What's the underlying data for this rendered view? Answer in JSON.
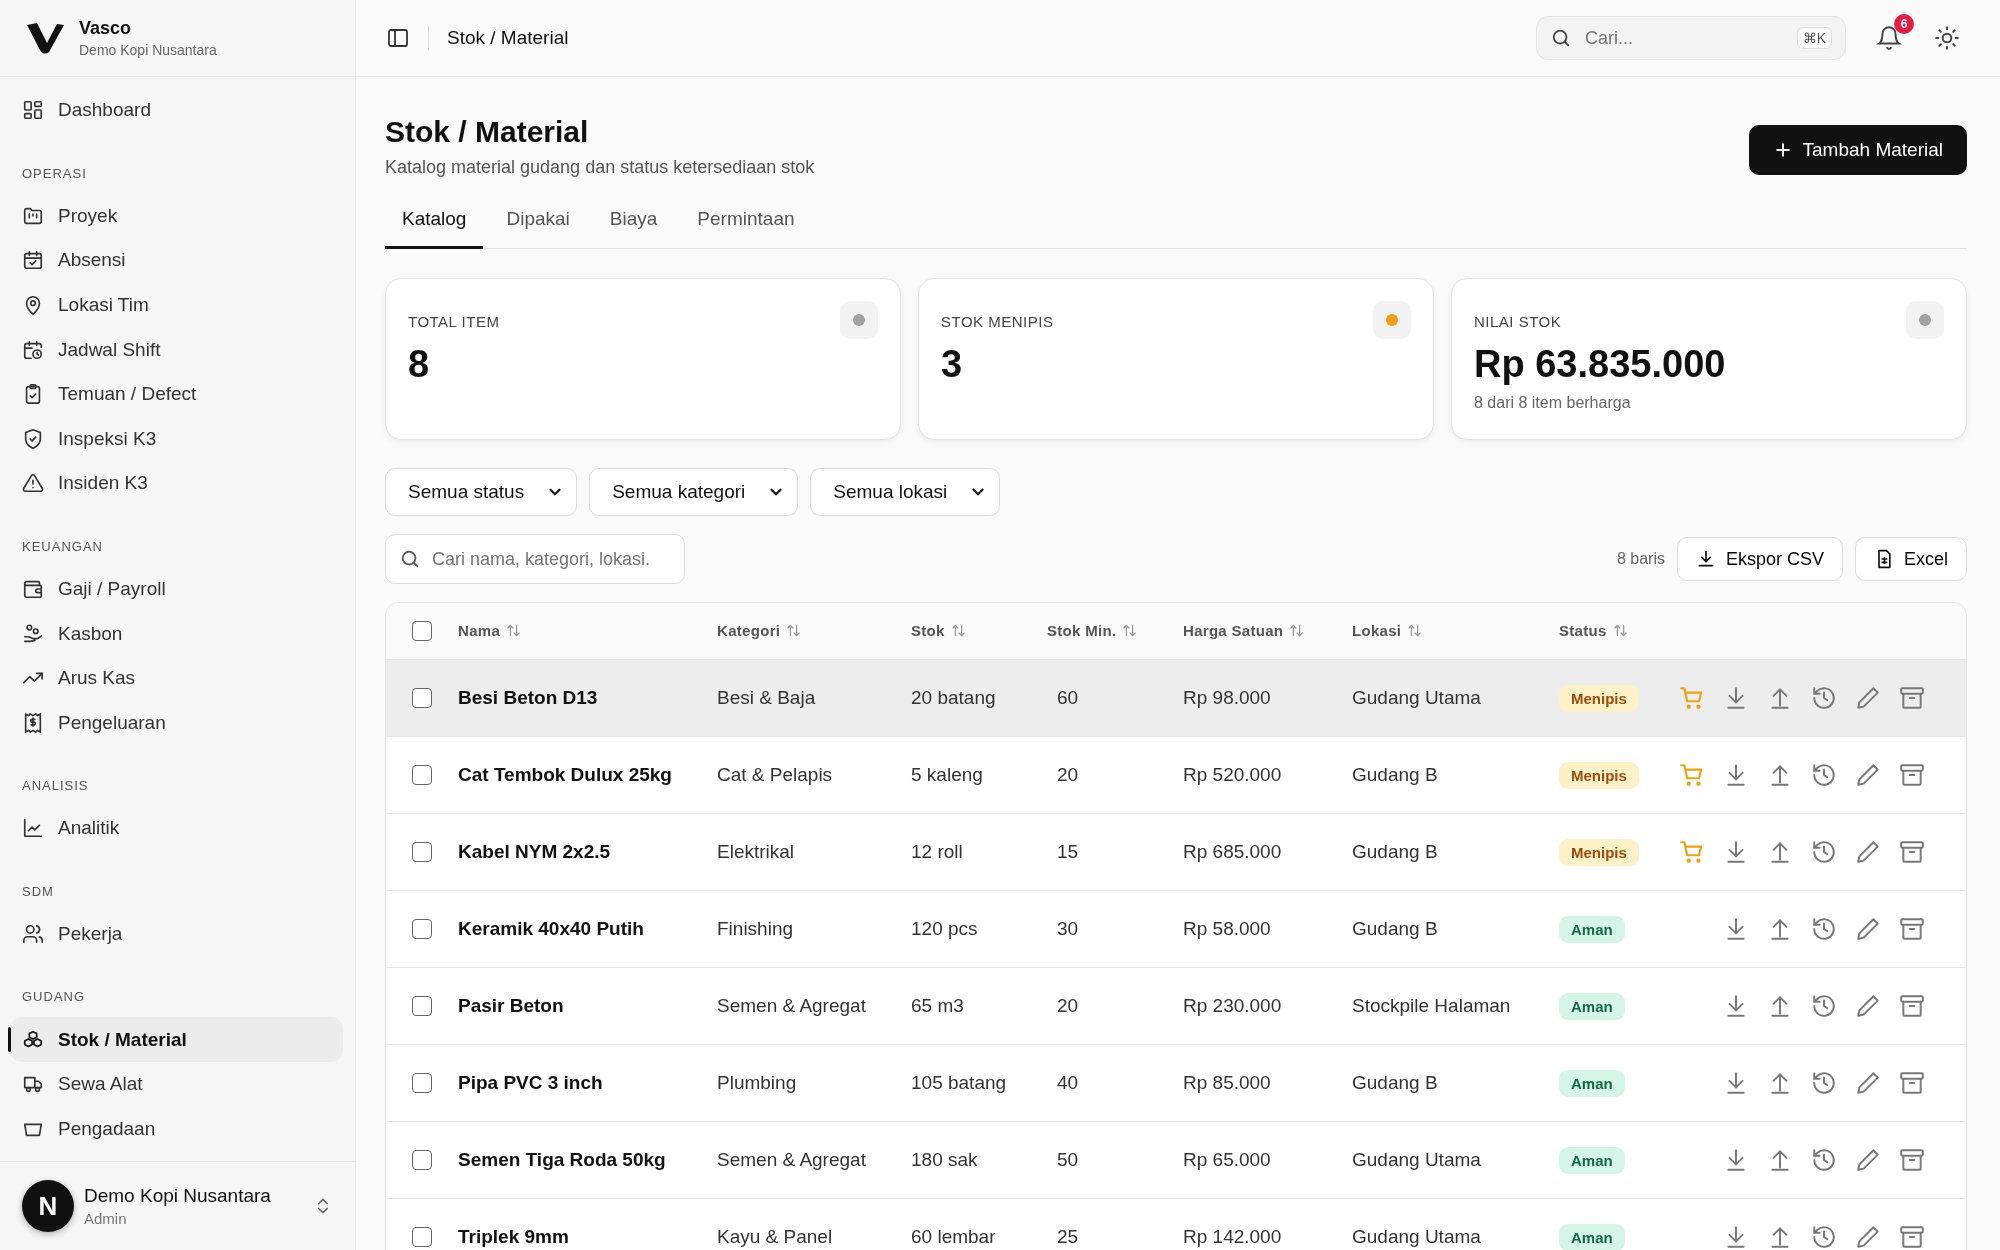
{
  "brand": {
    "name": "Vasco",
    "subtitle": "Demo Kopi Nusantara"
  },
  "sidebar": {
    "sections": [
      {
        "items": [
          {
            "label": "Dashboard",
            "selected": false
          }
        ]
      },
      {
        "title": "OPERASI",
        "items": [
          {
            "label": "Proyek",
            "selected": false
          },
          {
            "label": "Absensi",
            "selected": false
          },
          {
            "label": "Lokasi Tim",
            "selected": false
          },
          {
            "label": "Jadwal Shift",
            "selected": false
          },
          {
            "label": "Temuan / Defect",
            "selected": false
          },
          {
            "label": "Inspeksi K3",
            "selected": false
          },
          {
            "label": "Insiden K3",
            "selected": false
          }
        ]
      },
      {
        "title": "KEUANGAN",
        "items": [
          {
            "label": "Gaji / Payroll",
            "selected": false
          },
          {
            "label": "Kasbon",
            "selected": false
          },
          {
            "label": "Arus Kas",
            "selected": false
          },
          {
            "label": "Pengeluaran",
            "selected": false
          }
        ]
      },
      {
        "title": "ANALISIS",
        "items": [
          {
            "label": "Analitik",
            "selected": false
          }
        ]
      },
      {
        "title": "SDM",
        "items": [
          {
            "label": "Pekerja",
            "selected": false
          }
        ]
      },
      {
        "title": "GUDANG",
        "items": [
          {
            "label": "Stok / Material",
            "selected": true
          },
          {
            "label": "Sewa Alat",
            "selected": false
          },
          {
            "label": "Pengadaan",
            "selected": false
          }
        ]
      }
    ],
    "user": {
      "initial": "N",
      "name": "Demo Kopi Nusantara",
      "role": "Admin"
    }
  },
  "topbar": {
    "breadcrumb": "Stok / Material",
    "search": {
      "placeholder": "Cari...",
      "shortcut": "⌘K"
    },
    "notifications": "6"
  },
  "page": {
    "title": "Stok / Material",
    "subtitle": "Katalog material gudang dan status ketersediaan stok",
    "primary_button": "Tambah Material"
  },
  "tabs": [
    {
      "label": "Katalog",
      "selected": true
    },
    {
      "label": "Dipakai",
      "selected": false
    },
    {
      "label": "Biaya",
      "selected": false
    },
    {
      "label": "Permintaan",
      "selected": false
    }
  ],
  "stats": [
    {
      "label": "TOTAL ITEM",
      "value": "8",
      "color": "#a3a3a3"
    },
    {
      "label": "STOK MENIPIS",
      "value": "3",
      "color": "#f59e0b"
    },
    {
      "label": "NILAI STOK",
      "value": "Rp 63.835.000",
      "note": "8 dari 8 item berharga",
      "color": "#a3a3a3"
    }
  ],
  "filters": [
    {
      "value": "Semua status"
    },
    {
      "value": "Semua kategori"
    },
    {
      "value": "Semua lokasi"
    }
  ],
  "table_search": {
    "placeholder": "Cari nama, kategori, lokasi."
  },
  "row_count": "8 baris",
  "export_buttons": [
    "Ekspor CSV",
    "Excel"
  ],
  "table": {
    "select_all_checked": false,
    "columns": [
      "Nama",
      "Kategori",
      "Stok",
      "Stok Min.",
      "Harga Satuan",
      "Lokasi",
      "Status"
    ],
    "rows": [
      {
        "name": "Besi Beton D13",
        "category": "Besi & Baja",
        "stock": "20 batang",
        "min": "60",
        "price": "Rp 98.000",
        "location": "Gudang Utama",
        "status": "Menipis",
        "kind": "low",
        "checked": false,
        "highlighted": true
      },
      {
        "name": "Cat Tembok Dulux 25kg",
        "category": "Cat & Pelapis",
        "stock": "5 kaleng",
        "min": "20",
        "price": "Rp 520.000",
        "location": "Gudang B",
        "status": "Menipis",
        "kind": "low",
        "checked": false,
        "highlighted": false
      },
      {
        "name": "Kabel NYM 2x2.5",
        "category": "Elektrikal",
        "stock": "12 roll",
        "min": "15",
        "price": "Rp 685.000",
        "location": "Gudang B",
        "status": "Menipis",
        "kind": "low",
        "checked": false,
        "highlighted": false
      },
      {
        "name": "Keramik 40x40 Putih",
        "category": "Finishing",
        "stock": "120 pcs",
        "min": "30",
        "price": "Rp 58.000",
        "location": "Gudang B",
        "status": "Aman",
        "kind": "safe",
        "checked": false,
        "highlighted": false
      },
      {
        "name": "Pasir Beton",
        "category": "Semen & Agregat",
        "stock": "65 m3",
        "min": "20",
        "price": "Rp 230.000",
        "location": "Stockpile Halaman",
        "status": "Aman",
        "kind": "safe",
        "checked": false,
        "highlighted": false
      },
      {
        "name": "Pipa PVC 3 inch",
        "category": "Plumbing",
        "stock": "105 batang",
        "min": "40",
        "price": "Rp 85.000",
        "location": "Gudang B",
        "status": "Aman",
        "kind": "safe",
        "checked": false,
        "highlighted": false
      },
      {
        "name": "Semen Tiga Roda 50kg",
        "category": "Semen & Agregat",
        "stock": "180 sak",
        "min": "50",
        "price": "Rp 65.000",
        "location": "Gudang Utama",
        "status": "Aman",
        "kind": "safe",
        "checked": false,
        "highlighted": false
      },
      {
        "name": "Triplek 9mm",
        "category": "Kayu & Panel",
        "stock": "60 lembar",
        "min": "25",
        "price": "Rp 142.000",
        "location": "Gudang Utama",
        "status": "Aman",
        "kind": "safe",
        "checked": false,
        "highlighted": false
      }
    ]
  }
}
